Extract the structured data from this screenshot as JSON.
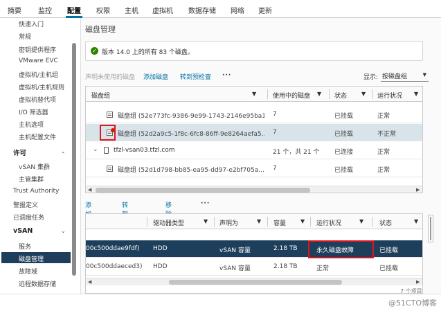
{
  "tabs": [
    "摘要",
    "监控",
    "配置",
    "权限",
    "主机",
    "虚拟机",
    "数据存储",
    "网络",
    "更新"
  ],
  "sidebar": {
    "top_items": [
      "快速入门",
      "常规",
      "密钥提供程序",
      "VMware EVC",
      "虚拟机/主机组",
      "虚拟机/主机规则",
      "虚拟机替代项",
      "I/O 筛选器",
      "主机选项",
      "主机配置文件"
    ],
    "section_license": "许可",
    "license_items": [
      "vSAN 集群",
      "主管集群"
    ],
    "plain_items": [
      "Trust Authority",
      "警报定义",
      "已调度任务"
    ],
    "section_vsan": "vSAN",
    "vsan_items": [
      "服务",
      "磁盘管理",
      "故障域",
      "远程数据存储"
    ]
  },
  "main": {
    "title": "磁盘管理",
    "info_text": "版本 14.0 上的所有 83 个磁盘。",
    "toolbar1": {
      "claim_unused": "声明未使用的磁盘",
      "add_disk": "添加磁盘",
      "precheck": "转到预检查",
      "more": "···",
      "show_label": "显示:",
      "show_value": "按磁盘组"
    },
    "grid1": {
      "headers": [
        "磁盘组",
        "使用中的磁盘",
        "状态",
        "运行状况"
      ],
      "rows": [
        {
          "name": "磁盘组 (52e773fc-9386-9e99-1743-2146e95ba1...",
          "disks": "7",
          "state": "已挂载",
          "health": "正常"
        },
        {
          "name": "磁盘组 (52d2a9c5-1f8c-6fc8-86ff-9e8264aefa5...",
          "disks": "7",
          "state": "已挂载",
          "health": "不正常"
        },
        {
          "name": "tfzl-vsan03.tfzl.com",
          "disks": "21 个，共 21 个",
          "state": "已连接",
          "health": "正常"
        },
        {
          "name": "磁盘组 (52d1d798-bb85-ea95-dd97-e2bf705a...",
          "disks": "7",
          "state": "已挂载",
          "health": "正常"
        }
      ]
    },
    "toolbar2": {
      "add_disk": "添加磁盘",
      "precheck": "转到预检查",
      "remove_disk": "移除磁盘",
      "more": "···"
    },
    "grid2": {
      "headers": [
        "驱动器类型",
        "声明为",
        "容量",
        "运行状况",
        "状态"
      ],
      "rows": [
        {
          "name": "00c500ddae9fdf)",
          "type": "HDD",
          "claimed": "vSAN 容量",
          "capacity": "2.18 TB",
          "health": "永久磁盘故障",
          "state": "已挂载"
        },
        {
          "name": "00c500ddaeced3)",
          "type": "HDD",
          "claimed": "vSAN 容量",
          "capacity": "2.18 TB",
          "health": "正常",
          "state": "已挂载"
        }
      ],
      "footer": "7 个项目"
    }
  },
  "watermark": "@51CTO博客"
}
